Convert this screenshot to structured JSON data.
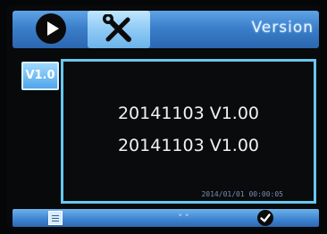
{
  "topbar": {
    "title": "Version",
    "play_icon": "play-icon",
    "tools_icon": "tools-icon"
  },
  "sidebar": {
    "version_badge": "V1.0"
  },
  "panel": {
    "version_line_1": "20141103 V1.00",
    "version_line_2": "20141103 V1.00",
    "timestamp": "2014/01/01 00:00:05"
  },
  "bottombar": {
    "menu_icon": "menu-icon",
    "arrows_icon": "double-chevron-down-icon",
    "confirm_icon": "checkmark-icon"
  },
  "colors": {
    "accent_blue": "#3b7fcb",
    "panel_border": "#68c8ef",
    "text": "#f2f2f2"
  }
}
